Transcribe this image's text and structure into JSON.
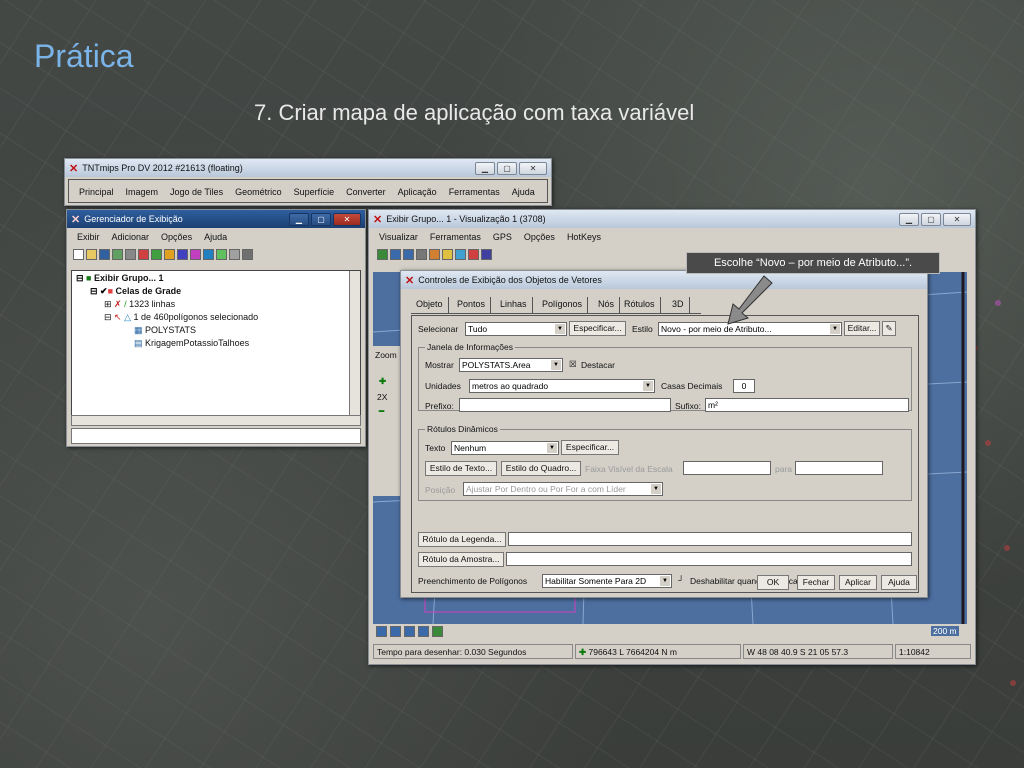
{
  "slide": {
    "title": "Prática",
    "subtitle": "7. Criar mapa de aplicação com taxa variável"
  },
  "main_window": {
    "title": "TNTmips Pro DV 2012  #21613 (floating)",
    "menu": [
      "Principal",
      "Imagem",
      "Jogo de Tiles",
      "Geométrico",
      "Superfície",
      "Converter",
      "Aplicação",
      "Ferramentas",
      "Ajuda"
    ]
  },
  "display_manager": {
    "title": "Gerenciador de Exibição",
    "menu": [
      "Exibir",
      "Adicionar",
      "Opções",
      "Ajuda"
    ],
    "tree": {
      "group": "Exibir Grupo... 1",
      "layer": "Celas de Grade",
      "lines": "1323 linhas",
      "polygons": "1 de 460polígonos selecionado",
      "polystats": "POLYSTATS",
      "krigagem": "KrigagemPotassioTalhoes"
    }
  },
  "view_window": {
    "title": "Exibir Grupo... 1 - Visualização 1 (3708)",
    "menu": [
      "Visualizar",
      "Ferramentas",
      "GPS",
      "Opções",
      "HotKeys"
    ],
    "zoom_label": "Zoom",
    "zoom_value": "2X",
    "scale_bar": "200 m",
    "status": {
      "draw_time": "Tempo para desenhar: 0.030 Segundos",
      "coords_map": "796643 L  7664204 N m",
      "coords_geo": "W 48 08 40.9  S 21 05 57.3",
      "scale": "1:10842"
    }
  },
  "dialog": {
    "title": "Controles de Exibição dos Objetos de Vetores",
    "tabs": [
      {
        "label": "Objeto",
        "enabled": true
      },
      {
        "label": "Pontos",
        "enabled": false
      },
      {
        "label": "Linhas",
        "enabled": true
      },
      {
        "label": "Polígonos",
        "enabled": true
      },
      {
        "label": "Nós",
        "enabled": true
      },
      {
        "label": "Rótulos",
        "enabled": false
      },
      {
        "label": "3D",
        "enabled": true
      }
    ],
    "select_label": "Selecionar",
    "select_value": "Tudo",
    "specify_button": "Especificar...",
    "style_label": "Estilo",
    "style_value": "Novo - por meio de Atributo...",
    "edit_button": "Editar...",
    "info_group": {
      "title": "Janela de Informações",
      "show_label": "Mostrar",
      "show_value": "POLYSTATS.Area",
      "highlight_label": "Destacar",
      "units_label": "Unidades",
      "units_value": "metros ao quadrado",
      "decimals_label": "Casas Decimais",
      "decimals_value": "0",
      "prefix_label": "Prefixo:",
      "suffix_label": "Sufixo:",
      "suffix_value": "m²"
    },
    "labels_group": {
      "title": "Rótulos Dinâmicos",
      "text_label": "Texto",
      "text_value": "Nenhum",
      "specify_button": "Especificar...",
      "text_style_button": "Estilo de Texto...",
      "frame_style_button": "Estilo do Quadro...",
      "scale_range_label": "Faixa Visível da Escala",
      "to_label": "para",
      "position_label": "Posição",
      "position_value": "Ajustar Por Dentro ou Por For a com Líder"
    },
    "legend_label_button": "Rótulo da Legenda...",
    "sample_label_button": "Rótulo da Amostra...",
    "fill_label": "Preenchimento de Polígonos",
    "fill_value": "Habilitar Somente Para 2D",
    "disable_highlight_label": "Deshabilitar quando destacado",
    "ok_button": "OK",
    "close_button": "Fechar",
    "apply_button": "Aplicar",
    "help_button": "Ajuda"
  },
  "callout": {
    "text": "Escolhe “Novo – por meio de Atributo...”."
  },
  "colors": {
    "title_blue": "#7ab4e8",
    "callout_bg": "#4a4a4a",
    "arrow_gray": "#8a8a8a"
  }
}
